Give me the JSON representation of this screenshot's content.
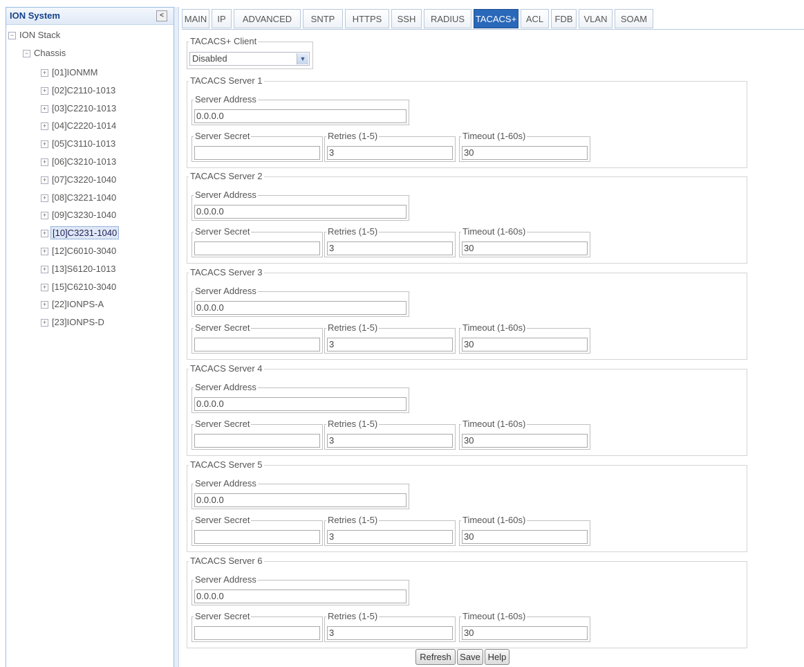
{
  "tree": {
    "header": "ION System",
    "collapse_icon": "chevron-left-icon",
    "nodes": [
      {
        "label": "ION Stack",
        "toggle": "−"
      },
      {
        "label": "Chassis",
        "toggle": "−"
      },
      {
        "label": "[01]IONMM",
        "toggle": "+"
      },
      {
        "label": "[02]C2110-1013",
        "toggle": "+"
      },
      {
        "label": "[03]C2210-1013",
        "toggle": "+"
      },
      {
        "label": "[04]C2220-1014",
        "toggle": "+"
      },
      {
        "label": "[05]C3110-1013",
        "toggle": "+"
      },
      {
        "label": "[06]C3210-1013",
        "toggle": "+"
      },
      {
        "label": "[07]C3220-1040",
        "toggle": "+"
      },
      {
        "label": "[08]C3221-1040",
        "toggle": "+"
      },
      {
        "label": "[09]C3230-1040",
        "toggle": "+"
      },
      {
        "label": "[10]C3231-1040",
        "toggle": "+"
      },
      {
        "label": "[12]C6010-3040",
        "toggle": "+"
      },
      {
        "label": "[13]S6120-1013",
        "toggle": "+"
      },
      {
        "label": "[15]C6210-3040",
        "toggle": "+"
      },
      {
        "label": "[22]IONPS-A",
        "toggle": "+"
      },
      {
        "label": "[23]IONPS-D",
        "toggle": "+"
      }
    ],
    "selected": "[10]C3231-1040"
  },
  "tabs": [
    "MAIN",
    "IP",
    "ADVANCED",
    "SNTP",
    "HTTPS",
    "SSH",
    "RADIUS",
    "TACACS+",
    "ACL",
    "FDB",
    "VLAN",
    "SOAM"
  ],
  "active_tab": "TACACS+",
  "client": {
    "legend": "TACACS+ Client",
    "value": "Disabled"
  },
  "labels": {
    "server_address": "Server Address",
    "server_secret": "Server Secret",
    "retries": "Retries (1-5)",
    "timeout": "Timeout (1-60s)"
  },
  "servers": [
    {
      "title": "TACACS Server 1",
      "address": "0.0.0.0",
      "secret": "",
      "retries": "3",
      "timeout": "30"
    },
    {
      "title": "TACACS Server 2",
      "address": "0.0.0.0",
      "secret": "",
      "retries": "3",
      "timeout": "30"
    },
    {
      "title": "TACACS Server 3",
      "address": "0.0.0.0",
      "secret": "",
      "retries": "3",
      "timeout": "30"
    },
    {
      "title": "TACACS Server 4",
      "address": "0.0.0.0",
      "secret": "",
      "retries": "3",
      "timeout": "30"
    },
    {
      "title": "TACACS Server 5",
      "address": "0.0.0.0",
      "secret": "",
      "retries": "3",
      "timeout": "30"
    },
    {
      "title": "TACACS Server 6",
      "address": "0.0.0.0",
      "secret": "",
      "retries": "3",
      "timeout": "30"
    }
  ],
  "buttons": {
    "refresh": "Refresh",
    "save": "Save",
    "help": "Help"
  },
  "colors": {
    "active_tab": "#2a68b9",
    "selected_node": "#dfe8f6",
    "panel_border": "#99bbe8"
  }
}
